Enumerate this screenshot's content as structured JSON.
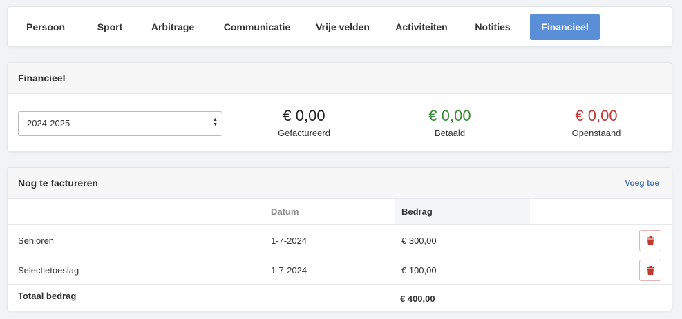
{
  "tabs": [
    {
      "label": "Persoon"
    },
    {
      "label": "Sport"
    },
    {
      "label": "Arbitrage"
    },
    {
      "label": "Communicatie"
    },
    {
      "label": "Vrije velden"
    },
    {
      "label": "Activiteiten"
    },
    {
      "label": "Notities"
    },
    {
      "label": "Financieel",
      "active": true
    }
  ],
  "financial": {
    "title": "Financieel",
    "season_value": "2024-2025",
    "stats": {
      "invoiced": {
        "amount": "€ 0,00",
        "label": "Gefactureerd"
      },
      "paid": {
        "amount": "€ 0,00",
        "label": "Betaald"
      },
      "outstanding": {
        "amount": "€ 0,00",
        "label": "Openstaand"
      }
    }
  },
  "invoices": {
    "title": "Nog te factureren",
    "add_label": "Voeg toe",
    "headers": {
      "date": "Datum",
      "amount": "Bedrag"
    },
    "rows": [
      {
        "name": "Senioren",
        "date": "1-7-2024",
        "amount": "€ 300,00"
      },
      {
        "name": "Selectietoeslag",
        "date": "1-7-2024",
        "amount": "€ 100,00"
      }
    ],
    "total_label": "Totaal bedrag",
    "total_amount": "€ 400,00"
  },
  "icons": {
    "trash": "trash-icon",
    "select_caret": "sort-caret-icon"
  },
  "colors": {
    "accent": "#5a8fd8",
    "positive": "#3a8a3a",
    "negative": "#c03a3a",
    "danger_icon": "#c0392b"
  }
}
